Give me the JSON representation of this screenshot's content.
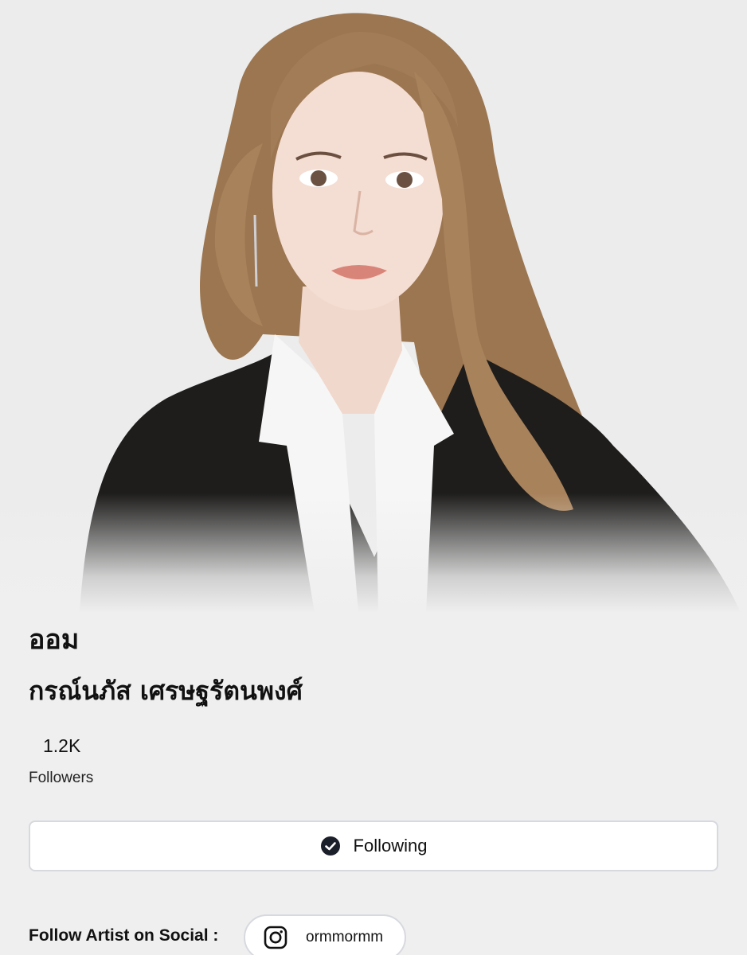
{
  "profile": {
    "nickname": "ออม",
    "full_name": "กรณ์นภัส เศรษฐรัตนพงศ์",
    "followers_count": "1.2K",
    "followers_label": "Followers",
    "portrait_icon": "artist-portrait"
  },
  "actions": {
    "follow_label": "Following",
    "follow_icon": "check-circle-icon"
  },
  "social": {
    "label": "Follow Artist on Social :",
    "instagram_handle": "ormmormm",
    "instagram_icon": "instagram-icon"
  },
  "colors": {
    "background": "#efefef",
    "button_border": "#d7d9de",
    "text": "#111111"
  }
}
